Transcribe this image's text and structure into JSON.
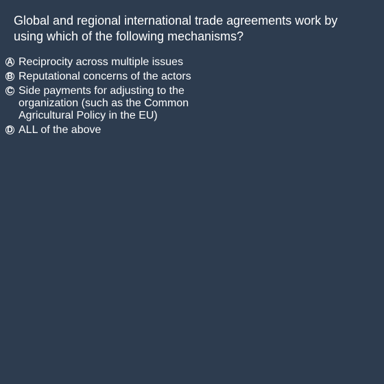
{
  "question": {
    "text": "Global and regional international trade agreements work by using which of the following mechanisms?"
  },
  "options": [
    {
      "letter": "A",
      "text": "Reciprocity across multiple issues"
    },
    {
      "letter": "B",
      "text": "Reputational concerns of the actors"
    },
    {
      "letter": "C",
      "text": "Side payments for adjusting to the organization (such as the Common Agricultural Policy in the EU)"
    },
    {
      "letter": "D",
      "text": "ALL of the above"
    }
  ],
  "colors": {
    "background": "#2d3c4f",
    "text": "#ffffff"
  }
}
